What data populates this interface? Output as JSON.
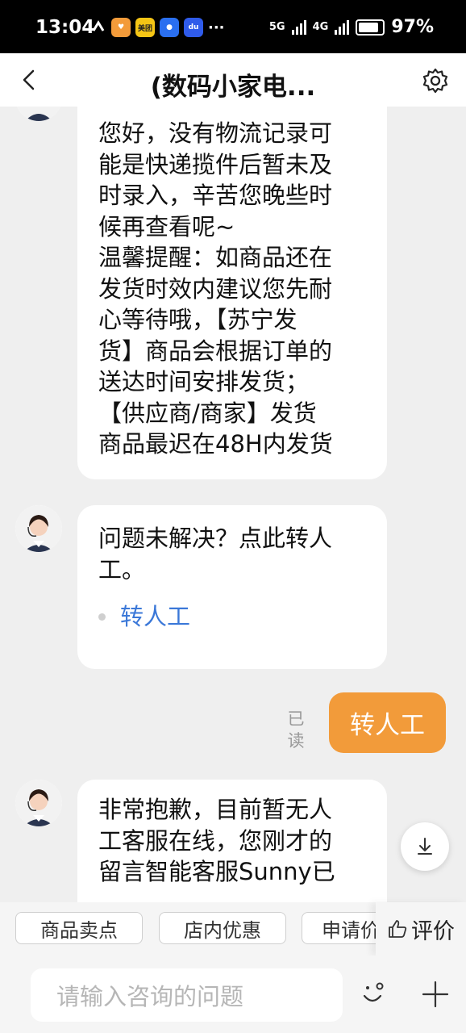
{
  "status_bar": {
    "time": "13:04",
    "network_5g": "5G",
    "network_4g": "4G",
    "battery": "97%",
    "more": "···"
  },
  "header": {
    "title": "(数码小家电..."
  },
  "messages": {
    "first_bubble_text": "您好，没有物流记录可\n能是快递揽件后暂未及\n时录入，辛苦您晚些时\n候再查看呢~\n温馨提醒：如商品还在\n发货时效内建议您先耐\n心等待哦，【苏宁发\n货】商品会根据订单的\n送达时间安排发货；\n【供应商/商家】发货\n商品最迟在48H内发货",
    "second_bubble_text": "问题未解决？点此转人\n工。",
    "transfer_link": "转人工",
    "read_status": "已\n读",
    "user_message": "转人工",
    "third_bubble_text": "非常抱歉，目前暂无人\n工客服在线，您刚才的\n留言智能客服Sunny已"
  },
  "quick_actions": [
    "商品卖点",
    "店内优惠",
    "申请价保"
  ],
  "rate_label": "评价",
  "input": {
    "placeholder": "请输入咨询的问题"
  }
}
